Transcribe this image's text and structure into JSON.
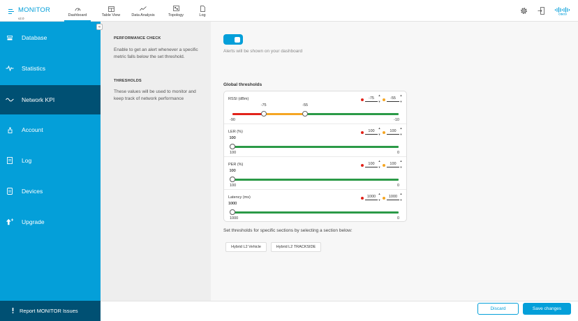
{
  "header": {
    "title": "MONITOR",
    "version": "v2.0",
    "nav": [
      {
        "label": "Dashboard",
        "icon": "speedometer-icon"
      },
      {
        "label": "Table View",
        "icon": "table-icon"
      },
      {
        "label": "Data Analysis",
        "icon": "chart-line-icon"
      },
      {
        "label": "Topology",
        "icon": "topology-icon"
      },
      {
        "label": "Log",
        "icon": "document-icon"
      }
    ],
    "active_nav": "Dashboard"
  },
  "sidebar": {
    "items": [
      {
        "label": "Database",
        "icon": "database-icon"
      },
      {
        "label": "Statistics",
        "icon": "pulse-icon"
      },
      {
        "label": "Network KPI",
        "icon": "wave-icon"
      },
      {
        "label": "Account",
        "icon": "user-icon"
      },
      {
        "label": "Log",
        "icon": "log-icon"
      },
      {
        "label": "Devices",
        "icon": "devices-icon"
      },
      {
        "label": "Upgrade",
        "icon": "upgrade-icon"
      }
    ],
    "active": "Network KPI",
    "report_label": "Report MONITOR Issues",
    "collapse_glyph": "«"
  },
  "performance_check": {
    "title": "PERFORMANCE CHECK",
    "description": "Enable to get an alert whenever a specific metric falls below the set threshold.",
    "enabled": true,
    "note": "Alerts will be shown on your dashboard"
  },
  "thresholds": {
    "title": "THRESHOLDS",
    "description": "These values will be used to monitor and keep track of network performance",
    "global_title": "Global thresholds",
    "colors": {
      "red": "#e2231a",
      "orange": "#f5a623",
      "green": "#2b9a47"
    },
    "metrics": [
      {
        "label": "RSSI (dBm)",
        "red_value": "-75",
        "orange_value": "-55",
        "min_label": "-90",
        "max_label": "-10",
        "handle1_label": "-75",
        "handle2_label": "-55",
        "min": -90,
        "max": -10,
        "handle1": -75,
        "handle2": -55
      },
      {
        "label": "LER (%)",
        "red_value": "100",
        "orange_value": "100",
        "min_label": "100",
        "max_label": "0",
        "handle1_label": "100",
        "handle2_label": "100",
        "min": 100,
        "max": 0,
        "handle1": 100,
        "handle2": 100
      },
      {
        "label": "PER (%)",
        "red_value": "100",
        "orange_value": "100",
        "min_label": "100",
        "max_label": "0",
        "handle1_label": "100",
        "handle2_label": "100",
        "min": 100,
        "max": 0,
        "handle1": 100,
        "handle2": 100
      },
      {
        "label": "Latency (ms)",
        "red_value": "1000",
        "orange_value": "1000",
        "min_label": "1000",
        "max_label": "0",
        "handle1_label": "1000",
        "handle2_label": "1000",
        "min": 1000,
        "max": 0,
        "handle1": 1000,
        "handle2": 1000
      }
    ]
  },
  "sections": {
    "hint": "Set thresholds for specific sections by selecting a section below:",
    "chips": [
      "Hybrid L2 Vehicle",
      "Hybrid L2 TRACKSIDE"
    ]
  },
  "footer": {
    "discard_label": "Discard",
    "save_label": "Save changes"
  },
  "stepper": {
    "up": "▲",
    "down": "▼"
  }
}
